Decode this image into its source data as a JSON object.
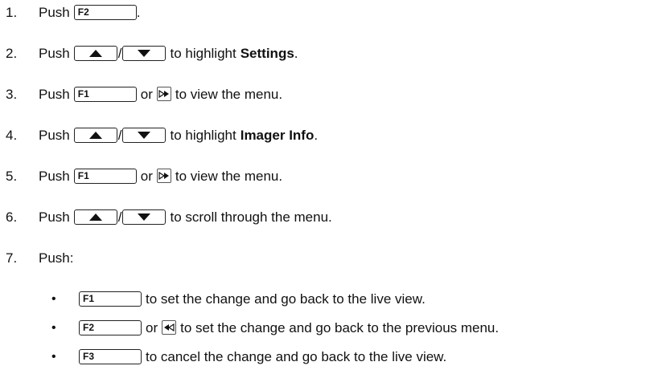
{
  "steps": [
    {
      "num": "1.",
      "text_a": "Push",
      "key": "F2",
      "text_b": "."
    },
    {
      "num": "2.",
      "text_a": "Push",
      "slash": "/",
      "text_b": "to highlight",
      "bold": "Settings",
      "text_c": "."
    },
    {
      "num": "3.",
      "text_a": "Push",
      "key": "F1",
      "text_b": "or",
      "text_c": "to view the menu."
    },
    {
      "num": "4.",
      "text_a": "Push",
      "slash": "/",
      "text_b": "to highlight",
      "bold": "Imager Info",
      "text_c": "."
    },
    {
      "num": "5.",
      "text_a": "Push",
      "key": "F1",
      "text_b": "or",
      "text_c": "to view the menu."
    },
    {
      "num": "6.",
      "text_a": "Push",
      "slash": "/",
      "text_b": "to scroll through the menu."
    },
    {
      "num": "7.",
      "text_a": "Push:"
    }
  ],
  "bullets": [
    {
      "mark": "•",
      "key": "F1",
      "text": "to set the change and go back to the live view."
    },
    {
      "mark": "•",
      "key": "F2",
      "text_or": "or",
      "text": "to set the change and go back to the previous menu."
    },
    {
      "mark": "•",
      "key": "F3",
      "text": "to cancel the change and go back to the live view."
    }
  ],
  "icons": {
    "up": "up-arrow-icon",
    "down": "down-arrow-icon",
    "forward": "forward-icon",
    "back": "back-icon"
  }
}
